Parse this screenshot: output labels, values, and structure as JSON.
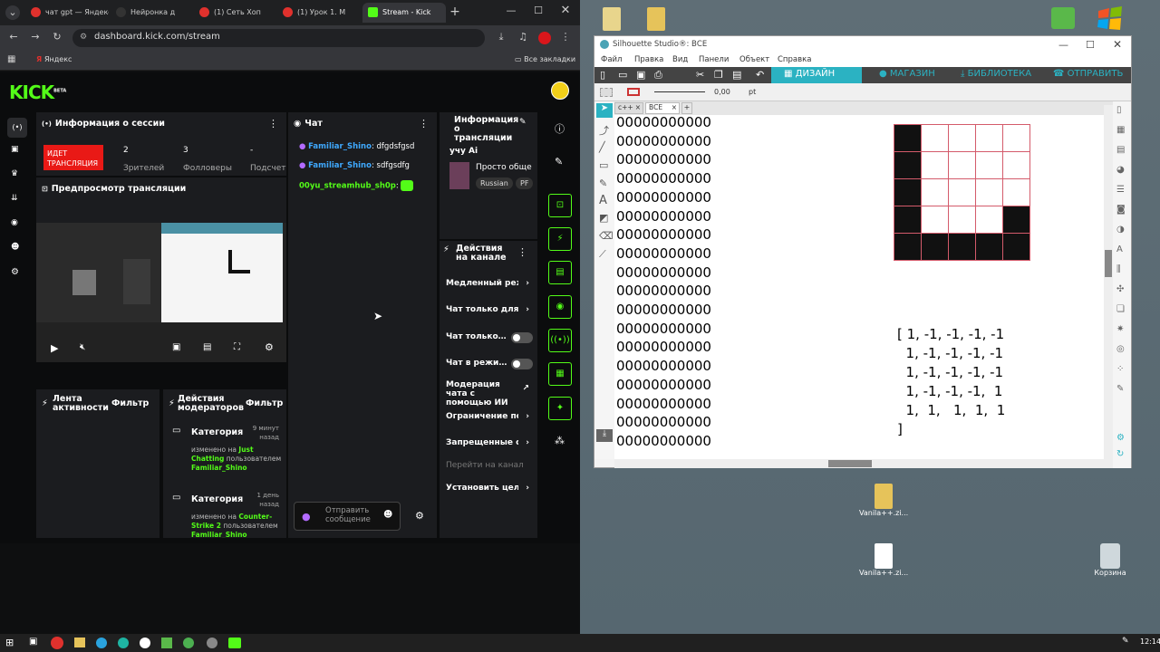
{
  "browser": {
    "tabs": [
      {
        "label": "чат gpt — Яндекс",
        "color": "#e0312d"
      },
      {
        "label": "Нейронка д",
        "color": "#333333"
      },
      {
        "label": "(1) Сеть Хоп",
        "color": "#e0312d"
      },
      {
        "label": "(1) Урок 1. М",
        "color": "#e0312d"
      },
      {
        "label": "Stream - Kick",
        "color": "#53fc18"
      }
    ],
    "url": "dashboard.kick.com/stream",
    "bookmark": "Яндекс",
    "all_bookmarks": "Все закладки"
  },
  "kick": {
    "logo": "KICK",
    "beta": "BETA",
    "session": {
      "title": "Информация о сессии",
      "live_badge": "ИДЕТ ТРАНСЛЯЦИЯ",
      "stats": [
        {
          "value": "2",
          "label": "Зрителей"
        },
        {
          "value": "3",
          "label": "Фолловеры"
        },
        {
          "value": "-",
          "label": "Подсчет"
        }
      ]
    },
    "preview": {
      "title": "Предпросмотр трансляции"
    },
    "chat": {
      "title": "Чат",
      "messages": [
        {
          "user": "Familiar_Shino",
          "text": "dfgdsfgsd"
        },
        {
          "user": "Familiar_Shino",
          "text": "sdfgsdfg"
        },
        {
          "user": "00yu_streamhub_sh0p",
          "text": ""
        }
      ],
      "input_placeholder": "Отправить сообщение"
    },
    "stream_info": {
      "title": "Информация о трансляции",
      "stream_title": "учу Ai",
      "category": "Просто обще",
      "tags": [
        "Russian",
        "PF"
      ]
    },
    "actions": {
      "title": "Действия на канале",
      "items": [
        "Медленный режим",
        "Чат только для фолловеров",
        "Чат только для подписчиков",
        "Чат в режиме эмодзи",
        "Модерация чата с помощью ИИ",
        "Ограничение по времени",
        "Запрещенные слова",
        "Перейти на канал",
        "Установить цели"
      ]
    },
    "activity": {
      "title": "Лента активности",
      "filter": "Фильтр"
    },
    "mod_actions": {
      "title": "Действия модераторов",
      "filter": "Фильтр",
      "entries": [
        {
          "label": "Категория",
          "time": "9 минут назад",
          "prefix": "изменено на",
          "value": "Just Chatting",
          "by": "пользователем",
          "user": "Familiar_Shino"
        },
        {
          "label": "Категория",
          "time": "1 день назад",
          "prefix": "изменено на",
          "value": "Counter-Strike 2",
          "by": "пользователем",
          "user": "Familiar_Shino"
        }
      ]
    }
  },
  "silhouette": {
    "title": "Silhouette Studio®: ВСЕ",
    "menu": [
      "Файл",
      "Правка",
      "Вид",
      "Панели",
      "Объект",
      "Справка"
    ],
    "tabs": [
      "ДИЗАЙН",
      "МАГАЗИН",
      "БИБЛИОТЕКА",
      "ОТПРАВИТЬ"
    ],
    "line_value": "0,00",
    "line_unit": "pt",
    "doc_tabs": [
      "c++",
      "ВСЕ"
    ],
    "zeros_row": "00000000000",
    "zeros_count": 18,
    "grid": [
      [
        1,
        0,
        0,
        0,
        0
      ],
      [
        1,
        0,
        0,
        0,
        0
      ],
      [
        1,
        0,
        0,
        0,
        0
      ],
      [
        1,
        0,
        0,
        0,
        1
      ],
      [
        1,
        1,
        1,
        1,
        1
      ]
    ],
    "matrix_lines": [
      "[ 1, -1, -1, -1, -1",
      "  1, -1, -1, -1, -1",
      "  1, -1, -1, -1, -1",
      "  1, -1, -1, -1,  1",
      "  1,  1,   1,  1,  1",
      "]"
    ]
  },
  "desktop": {
    "icons": [
      {
        "label": "Vanila++.zi..."
      },
      {
        "label": "Vanila++.zi..."
      },
      {
        "label": "Корзина"
      }
    ]
  },
  "taskbar": {
    "time": "12:14"
  }
}
